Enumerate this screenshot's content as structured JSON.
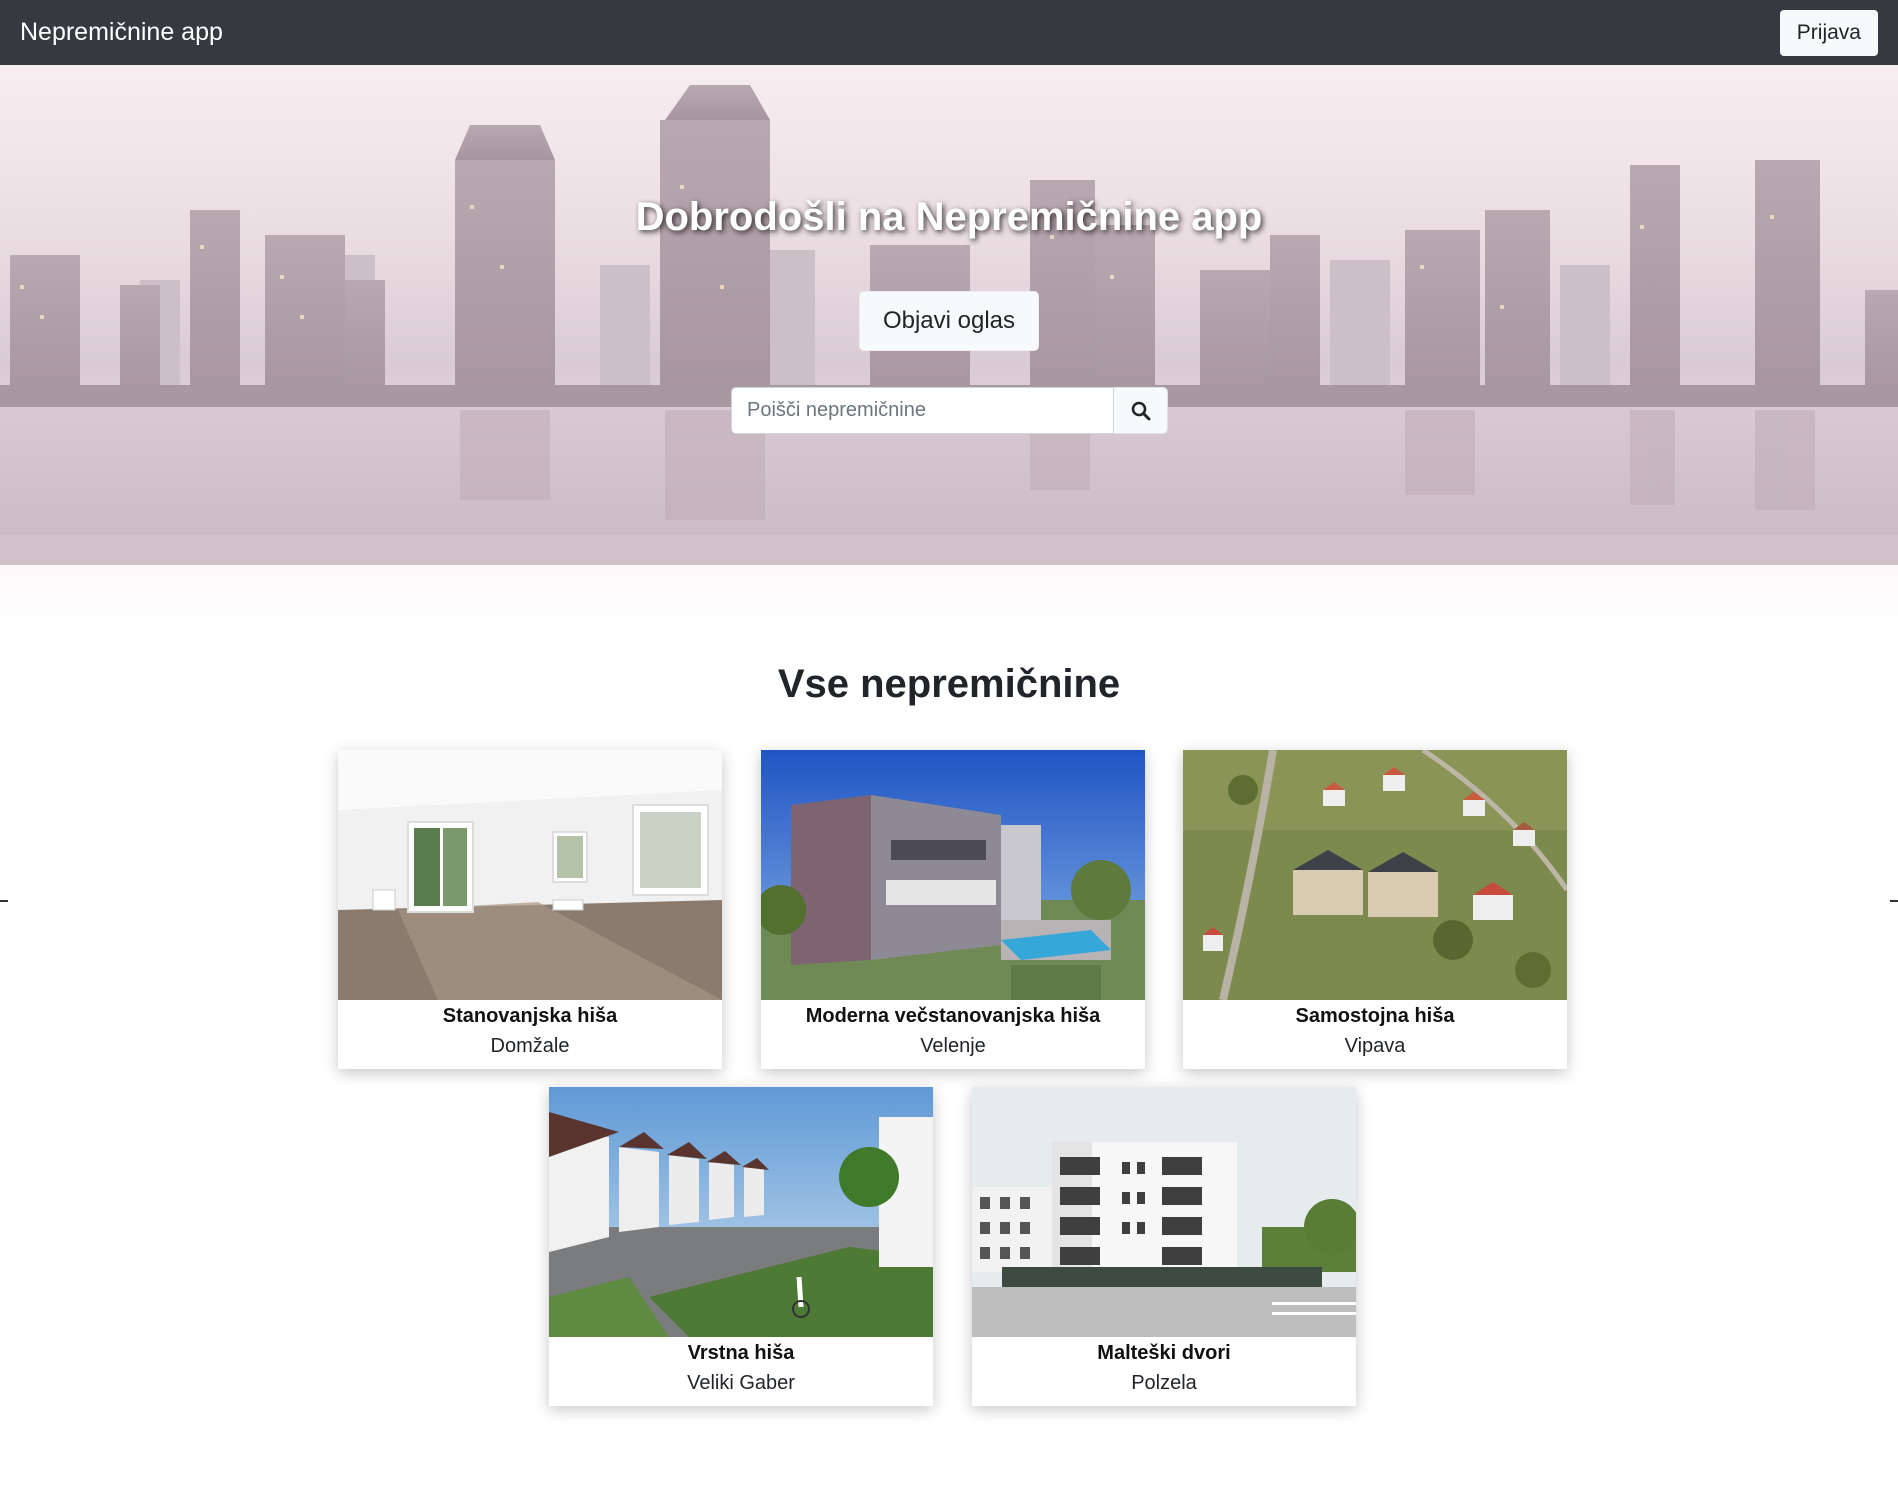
{
  "navbar": {
    "brand": "Nepremičnine app",
    "login_label": "Prijava"
  },
  "hero": {
    "title": "Dobrodošli na Nepremičnine app",
    "publish_label": "Objavi oglas",
    "search_placeholder": "Poišči nepremičnine",
    "search_icon": "search-icon"
  },
  "section": {
    "title": "Vse nepremičnine"
  },
  "listings": [
    {
      "title": "Stanovanjska hiša",
      "city": "Domžale",
      "image": "empty-room-interior"
    },
    {
      "title": "Moderna večstanovanjska hiša",
      "city": "Velenje",
      "image": "modern-villa-with-pool"
    },
    {
      "title": "Samostojna hiša",
      "city": "Vipava",
      "image": "aerial-village-houses"
    },
    {
      "title": "Vrstna hiša",
      "city": "Veliki Gaber",
      "image": "row-houses-street"
    },
    {
      "title": "Malteški dvori",
      "city": "Polzela",
      "image": "apartment-block"
    }
  ],
  "colors": {
    "navbar": "#343a40",
    "button_light": "#f8f9fa",
    "text": "#212529"
  }
}
